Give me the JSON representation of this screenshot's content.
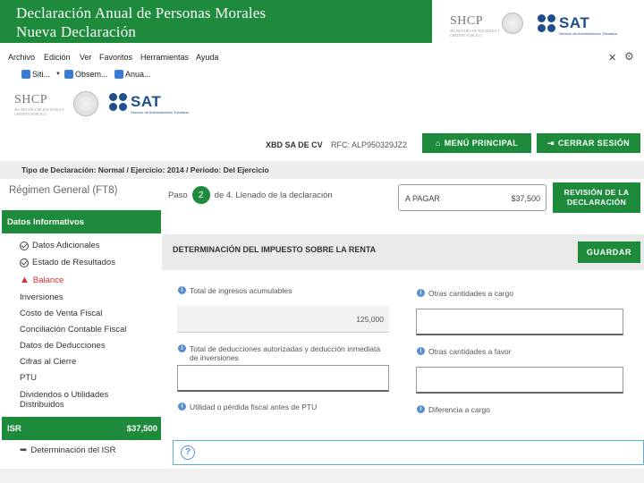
{
  "slide": {
    "title_line1": "Declaración Anual de Personas Morales",
    "title_line2": "Nueva Declaración"
  },
  "logos": {
    "shcp_text": "SHCP",
    "shcp_sub": "SECRETARÍA DE HACIENDA Y CRÉDITO PÚBLICO",
    "sat_text": "SAT",
    "sat_sub": "Servicio de Administración Tributaria"
  },
  "browser": {
    "menu": [
      "Archivo",
      "Edición",
      "Ver",
      "Favoritos",
      "Herramientas",
      "Ayuda"
    ],
    "favorites": [
      "Siti...",
      "Obsem...",
      "Anua..."
    ]
  },
  "header": {
    "company": "XBD SA DE CV",
    "rfc": "RFC: ALP950329JZ2",
    "main_menu_label": "MENÚ PRINCIPAL",
    "logout_label": "CERRAR SESIÓN"
  },
  "breadcrumb": "Tipo de Declaración: Normal / Ejercicio: 2014 / Periodo: Del Ejercicio",
  "sidebar": {
    "regime": "Régimen General (FT8)",
    "datos_head": "Datos Informativos",
    "items": [
      {
        "label": "Datos Adicionales",
        "status": "check"
      },
      {
        "label": "Estado de Resultados",
        "status": "check"
      },
      {
        "label": "Balance",
        "status": "warning"
      },
      {
        "label": "Inversiones",
        "status": "none"
      },
      {
        "label": "Costo de Venta Fiscal",
        "status": "none"
      },
      {
        "label": "Conciliación Contable Fiscal",
        "status": "none"
      },
      {
        "label": "Datos de Deducciones",
        "status": "none"
      },
      {
        "label": "Cifras al Cierre",
        "status": "none"
      },
      {
        "label": "PTU",
        "status": "none"
      },
      {
        "label": "Dividendos o Utilidades Distribuidos",
        "status": "none"
      }
    ],
    "isr_label": "ISR",
    "isr_amount": "$37,500",
    "isr_sub": "Determinación del ISR"
  },
  "main": {
    "step_prefix": "Paso",
    "step_number": "2",
    "step_suffix": "de 4. Llenado de la declaración",
    "total_label": "A PAGAR",
    "total_amount": "$37,500",
    "review_label": "REVISIÓN DE LA DECLARACIÓN",
    "section_title": "DETERMINACIÓN DEL IMPUESTO SOBRE LA RENTA",
    "save_label": "GUARDAR",
    "fields": {
      "total_ingresos_label": "Total de ingresos acumulables",
      "total_ingresos_value": "125,000",
      "otras_cargo_label": "Otras cantidades a cargo",
      "total_deducciones_label": "Total de deducciones autorizadas y deducción inmediata de inversiones",
      "otras_favor_label": "Otras cantidades a favor",
      "utilidad_label": "Utilidad o pérdida fiscal antes de PTU",
      "diferencia_label": "Diferencia a cargo"
    }
  }
}
